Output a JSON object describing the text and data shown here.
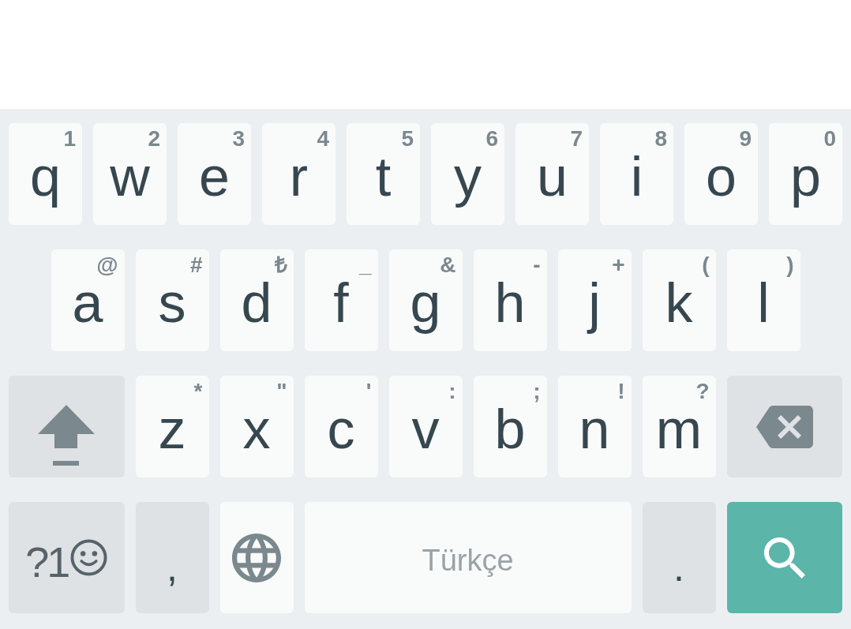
{
  "keyboard": {
    "rows": [
      {
        "keys": [
          {
            "kind": "letter",
            "label": "q",
            "hint": "1"
          },
          {
            "kind": "letter",
            "label": "w",
            "hint": "2"
          },
          {
            "kind": "letter",
            "label": "e",
            "hint": "3"
          },
          {
            "kind": "letter",
            "label": "r",
            "hint": "4"
          },
          {
            "kind": "letter",
            "label": "t",
            "hint": "5"
          },
          {
            "kind": "letter",
            "label": "y",
            "hint": "6"
          },
          {
            "kind": "letter",
            "label": "u",
            "hint": "7"
          },
          {
            "kind": "letter",
            "label": "i",
            "hint": "8"
          },
          {
            "kind": "letter",
            "label": "o",
            "hint": "9"
          },
          {
            "kind": "letter",
            "label": "p",
            "hint": "0"
          }
        ]
      },
      {
        "keys": [
          {
            "kind": "letter",
            "label": "a",
            "hint": "@"
          },
          {
            "kind": "letter",
            "label": "s",
            "hint": "#"
          },
          {
            "kind": "letter",
            "label": "d",
            "hint": "₺"
          },
          {
            "kind": "letter",
            "label": "f",
            "hint": "_"
          },
          {
            "kind": "letter",
            "label": "g",
            "hint": "&"
          },
          {
            "kind": "letter",
            "label": "h",
            "hint": "-"
          },
          {
            "kind": "letter",
            "label": "j",
            "hint": "+"
          },
          {
            "kind": "letter",
            "label": "k",
            "hint": "("
          },
          {
            "kind": "letter",
            "label": "l",
            "hint": ")"
          }
        ]
      },
      {
        "keys": [
          {
            "kind": "shift"
          },
          {
            "kind": "letter",
            "label": "z",
            "hint": "*"
          },
          {
            "kind": "letter",
            "label": "x",
            "hint": "\""
          },
          {
            "kind": "letter",
            "label": "c",
            "hint": "'"
          },
          {
            "kind": "letter",
            "label": "v",
            "hint": ":"
          },
          {
            "kind": "letter",
            "label": "b",
            "hint": ";"
          },
          {
            "kind": "letter",
            "label": "n",
            "hint": "!"
          },
          {
            "kind": "letter",
            "label": "m",
            "hint": "?"
          },
          {
            "kind": "backspace"
          }
        ]
      },
      {
        "keys": [
          {
            "kind": "symbols",
            "label": "?1"
          },
          {
            "kind": "punctuation",
            "label": ","
          },
          {
            "kind": "language"
          },
          {
            "kind": "space",
            "label": "Türkçe"
          },
          {
            "kind": "punctuation",
            "label": "."
          },
          {
            "kind": "search"
          }
        ]
      }
    ]
  }
}
